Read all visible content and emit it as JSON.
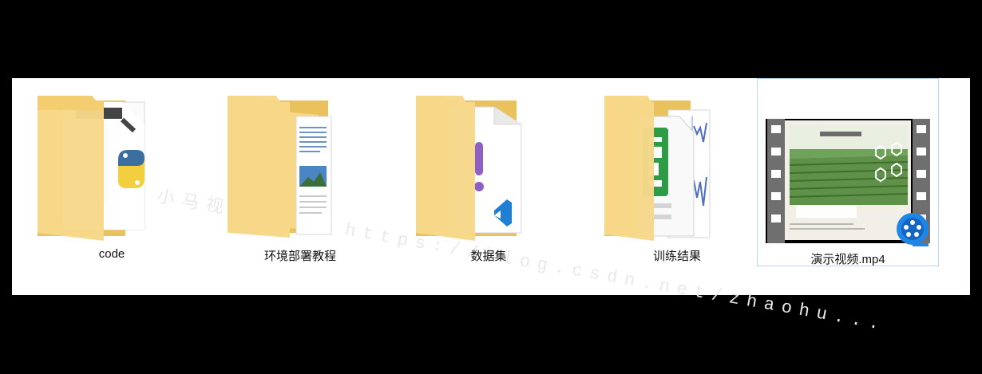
{
  "files": [
    {
      "name": "code",
      "type": "folder",
      "preview": "python"
    },
    {
      "name": "环境部署教程",
      "type": "folder",
      "preview": "document"
    },
    {
      "name": "数据集",
      "type": "folder",
      "preview": "vscode"
    },
    {
      "name": "训练结果",
      "type": "folder",
      "preview": "excel"
    },
    {
      "name": "演示视频.mp4",
      "type": "video",
      "preview": "video-thumbnail"
    }
  ],
  "watermark": "小马视觉工作室 https://blog.csdn.net/zhaohu...",
  "colors": {
    "folder_back": "#e9c25e",
    "folder_front": "#f7d889",
    "python_blue": "#3a6f9f",
    "python_yellow": "#f3cf3f",
    "vscode_blue": "#1f7fd3",
    "excel_green": "#2e9b45",
    "selection_border": "#b9d7f2"
  }
}
